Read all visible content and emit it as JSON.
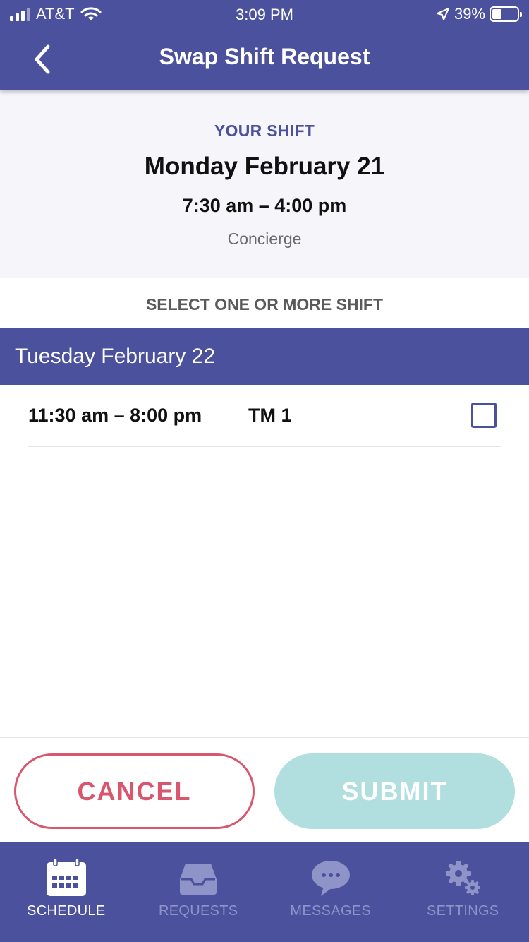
{
  "status_bar": {
    "carrier": "AT&T",
    "time": "3:09 PM",
    "battery": "39%",
    "battery_level": 0.39
  },
  "nav": {
    "title": "Swap Shift Request",
    "back_icon": "chevron-left-icon"
  },
  "your_shift": {
    "label": "YOUR SHIFT",
    "date": "Monday February 21",
    "time": "7:30 am – 4:00 pm",
    "position": "Concierge"
  },
  "select_label": "SELECT ONE OR MORE SHIFT",
  "day_groups": [
    {
      "date": "Tuesday February 22",
      "shifts": [
        {
          "time": "11:30 am – 8:00 pm",
          "position": "TM 1",
          "checked": false
        }
      ]
    }
  ],
  "actions": {
    "cancel_label": "CANCEL",
    "submit_label": "SUBMIT"
  },
  "tabs": [
    {
      "label": "SCHEDULE",
      "icon": "calendar-icon",
      "active": true
    },
    {
      "label": "REQUESTS",
      "icon": "inbox-icon",
      "active": false
    },
    {
      "label": "MESSAGES",
      "icon": "chat-bubble-icon",
      "active": false
    },
    {
      "label": "SETTINGS",
      "icon": "gears-icon",
      "active": false
    }
  ],
  "colors": {
    "primary": "#4b519c",
    "cancel": "#d9566f",
    "submit_disabled": "#b1dfdf",
    "inactive_tab": "#8e93c8"
  }
}
